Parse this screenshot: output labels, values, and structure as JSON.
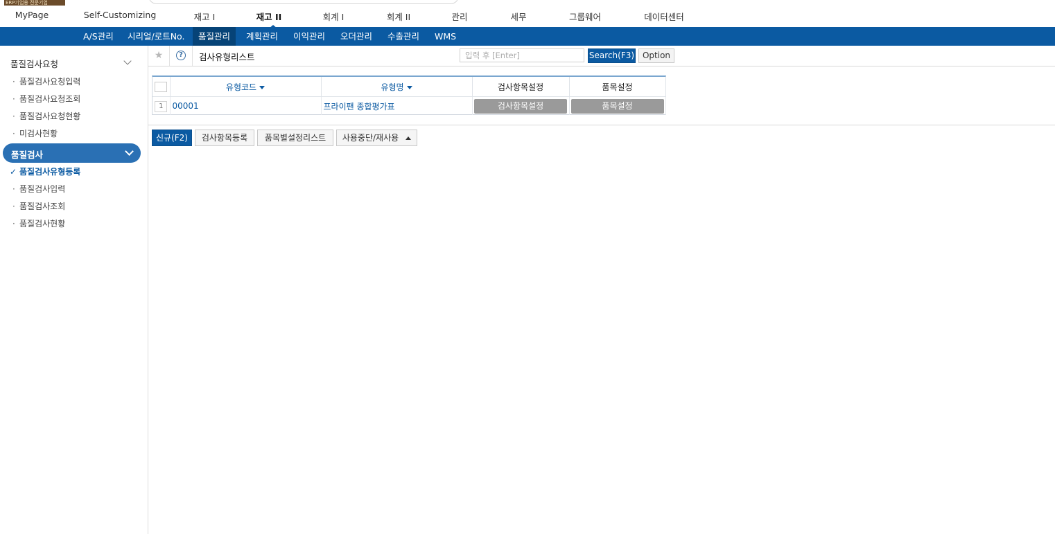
{
  "top_badge": "ERP기업용 전문기업",
  "top_nav": [
    {
      "label": "MyPage",
      "active": false
    },
    {
      "label": "Self-Customizing",
      "active": false
    },
    {
      "label": "재고 I",
      "active": false
    },
    {
      "label": "재고 II",
      "active": true
    },
    {
      "label": "회계 I",
      "active": false
    },
    {
      "label": "회계 II",
      "active": false
    },
    {
      "label": "관리",
      "active": false
    },
    {
      "label": "세무",
      "active": false
    },
    {
      "label": "그룹웨어",
      "active": false
    },
    {
      "label": "데이터센터",
      "active": false
    }
  ],
  "sub_nav": [
    {
      "label": "A/S관리",
      "active": false
    },
    {
      "label": "시리얼/로트No.",
      "active": false
    },
    {
      "label": "품질관리",
      "active": true
    },
    {
      "label": "계획관리",
      "active": false
    },
    {
      "label": "이익관리",
      "active": false
    },
    {
      "label": "오더관리",
      "active": false
    },
    {
      "label": "수출관리",
      "active": false
    },
    {
      "label": "WMS",
      "active": false
    }
  ],
  "sidebar": {
    "group1": {
      "label": "품질검사요청",
      "items": [
        "품질검사요청입력",
        "품질검사요청조회",
        "품질검사요청현황",
        "미검사현황"
      ]
    },
    "group2": {
      "label": "품질검사",
      "current": "품질검사유형등록",
      "items": [
        "품질검사입력",
        "품질검사조회",
        "품질검사현황"
      ]
    }
  },
  "toolbar": {
    "title": "검사유형리스트",
    "search_placeholder": "입력 후 [Enter]",
    "search_button": "Search(F3)",
    "option_button": "Option"
  },
  "grid": {
    "columns": [
      {
        "label": "유형코드",
        "sortable": true
      },
      {
        "label": "유형명",
        "sortable": true
      },
      {
        "label": "검사항목설정",
        "sortable": false
      },
      {
        "label": "품목설정",
        "sortable": false
      }
    ],
    "rows": [
      {
        "num": "1",
        "code": "00001",
        "name": "프라이팬 종합평가표",
        "btn1": "검사항목설정",
        "btn2": "품목설정"
      }
    ]
  },
  "actions": {
    "new": "신규(F2)",
    "register_items": "검사항목등록",
    "item_settings_list": "품목별설정리스트",
    "stop_reuse": "사용중단/재사용"
  }
}
